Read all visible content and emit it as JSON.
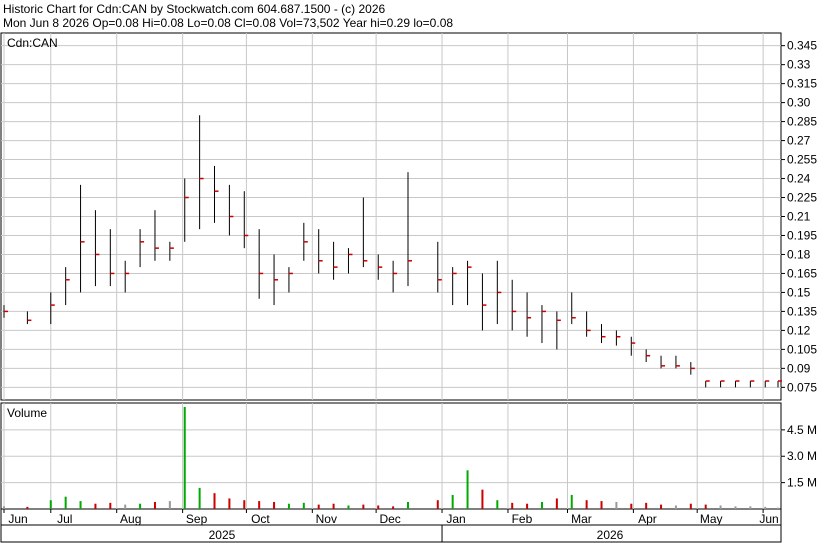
{
  "header": {
    "line1": "Historic Chart for Cdn:CAN by Stockwatch.com 604.687.1500 - (c) 2026",
    "line2": "Mon Jun  8 2026  Op=0.08  Hi=0.08  Lo=0.08  Cl=0.08  Vol=73,502  Year hi=0.29  lo=0.08"
  },
  "colors": {
    "price": "#000000",
    "close_tick": "#cc0000",
    "vol_up": "#00aa00",
    "vol_down": "#cc0000",
    "vol_flat": "#999999",
    "grid": "#c8c8c8"
  },
  "chart_data": [
    {
      "type": "bar",
      "title": "Cdn:CAN",
      "ylabel": "",
      "ylim": [
        0.065,
        0.355
      ],
      "y_ticks": [
        "0.345",
        "0.33",
        "0.315",
        "0.30",
        "0.285",
        "0.27",
        "0.255",
        "0.24",
        "0.225",
        "0.21",
        "0.195",
        "0.18",
        "0.165",
        "0.15",
        "0.135",
        "0.12",
        "0.105",
        "0.09",
        "0.075"
      ],
      "y_tick_values": [
        0.345,
        0.33,
        0.315,
        0.3,
        0.285,
        0.27,
        0.255,
        0.24,
        0.225,
        0.21,
        0.195,
        0.18,
        0.165,
        0.15,
        0.135,
        0.12,
        0.105,
        0.09,
        0.075
      ],
      "grid": true,
      "x_range": [
        "2025-06-09",
        "2026-06-08"
      ],
      "month_labels": [
        {
          "label": "Jun",
          "date": "2025-06-09"
        },
        {
          "label": "Jul",
          "date": "2025-07-01"
        },
        {
          "label": "Aug",
          "date": "2025-08-01"
        },
        {
          "label": "Sep",
          "date": "2025-09-01"
        },
        {
          "label": "Oct",
          "date": "2025-10-01"
        },
        {
          "label": "Nov",
          "date": "2025-11-01"
        },
        {
          "label": "Dec",
          "date": "2025-12-01"
        },
        {
          "label": "Jan",
          "date": "2026-01-01"
        },
        {
          "label": "Feb",
          "date": "2026-02-01"
        },
        {
          "label": "Mar",
          "date": "2026-03-01"
        },
        {
          "label": "Apr",
          "date": "2026-04-01"
        },
        {
          "label": "May",
          "date": "2026-05-01"
        },
        {
          "label": "Jun",
          "date": "2026-06-01"
        }
      ],
      "year_labels": [
        {
          "label": "2025",
          "from": "2025-06-09",
          "to": "2025-12-31"
        },
        {
          "label": "2026",
          "from": "2026-01-01",
          "to": "2026-06-08"
        }
      ],
      "series": [
        {
          "x": [
            "2025-06-09",
            "2025-06-20",
            "2025-07-01",
            "2025-07-08",
            "2025-07-15",
            "2025-07-22",
            "2025-07-29",
            "2025-08-05",
            "2025-08-12",
            "2025-08-19",
            "2025-08-26",
            "2025-09-02",
            "2025-09-09",
            "2025-09-16",
            "2025-09-23",
            "2025-09-30",
            "2025-10-07",
            "2025-10-14",
            "2025-10-21",
            "2025-10-28",
            "2025-11-04",
            "2025-11-11",
            "2025-11-18",
            "2025-11-25",
            "2025-12-02",
            "2025-12-09",
            "2025-12-16",
            "2025-12-30",
            "2026-01-06",
            "2026-01-13",
            "2026-01-20",
            "2026-01-27",
            "2026-02-03",
            "2026-02-10",
            "2026-02-17",
            "2026-02-24",
            "2026-03-03",
            "2026-03-10",
            "2026-03-17",
            "2026-03-24",
            "2026-03-31",
            "2026-04-07",
            "2026-04-14",
            "2026-04-21",
            "2026-04-28",
            "2026-05-05",
            "2026-05-12",
            "2026-05-19",
            "2026-05-26",
            "2026-06-02",
            "2026-06-08"
          ],
          "high": [
            0.14,
            0.135,
            0.15,
            0.17,
            0.235,
            0.215,
            0.2,
            0.175,
            0.2,
            0.215,
            0.19,
            0.24,
            0.29,
            0.25,
            0.235,
            0.23,
            0.2,
            0.18,
            0.17,
            0.205,
            0.2,
            0.19,
            0.185,
            0.225,
            0.18,
            0.175,
            0.245,
            0.19,
            0.17,
            0.175,
            0.165,
            0.175,
            0.16,
            0.15,
            0.14,
            0.135,
            0.15,
            0.135,
            0.125,
            0.12,
            0.115,
            0.105,
            0.1,
            0.1,
            0.095,
            0.08,
            0.08,
            0.08,
            0.08,
            0.08,
            0.08
          ],
          "low": [
            0.13,
            0.125,
            0.125,
            0.14,
            0.15,
            0.155,
            0.155,
            0.15,
            0.17,
            0.175,
            0.175,
            0.19,
            0.2,
            0.205,
            0.195,
            0.185,
            0.145,
            0.14,
            0.15,
            0.175,
            0.165,
            0.16,
            0.165,
            0.17,
            0.16,
            0.15,
            0.155,
            0.15,
            0.14,
            0.14,
            0.12,
            0.125,
            0.12,
            0.115,
            0.11,
            0.105,
            0.125,
            0.115,
            0.11,
            0.108,
            0.1,
            0.095,
            0.09,
            0.09,
            0.085,
            0.075,
            0.075,
            0.075,
            0.075,
            0.075,
            0.075
          ],
          "close": [
            0.135,
            0.128,
            0.14,
            0.16,
            0.19,
            0.18,
            0.165,
            0.165,
            0.19,
            0.185,
            0.185,
            0.225,
            0.24,
            0.23,
            0.21,
            0.195,
            0.165,
            0.16,
            0.165,
            0.19,
            0.175,
            0.17,
            0.18,
            0.175,
            0.17,
            0.165,
            0.175,
            0.16,
            0.165,
            0.17,
            0.14,
            0.15,
            0.135,
            0.13,
            0.135,
            0.128,
            0.13,
            0.12,
            0.115,
            0.115,
            0.11,
            0.1,
            0.092,
            0.092,
            0.09,
            0.08,
            0.08,
            0.08,
            0.08,
            0.08,
            0.08
          ]
        }
      ]
    },
    {
      "type": "bar",
      "title": "Volume",
      "y_ticks": [
        "4.5 M",
        "3.0 M",
        "1.5 M"
      ],
      "y_tick_values": [
        4500000,
        3000000,
        1500000
      ],
      "ylim": [
        0,
        5800000
      ],
      "series": [
        {
          "x": [
            "2025-06-09",
            "2025-06-20",
            "2025-07-01",
            "2025-07-08",
            "2025-07-15",
            "2025-07-22",
            "2025-07-29",
            "2025-08-05",
            "2025-08-12",
            "2025-08-19",
            "2025-08-26",
            "2025-09-02",
            "2025-09-09",
            "2025-09-16",
            "2025-09-23",
            "2025-09-30",
            "2025-10-07",
            "2025-10-14",
            "2025-10-21",
            "2025-10-28",
            "2025-11-04",
            "2025-11-11",
            "2025-11-18",
            "2025-11-25",
            "2025-12-02",
            "2025-12-09",
            "2025-12-16",
            "2025-12-30",
            "2026-01-06",
            "2026-01-13",
            "2026-01-20",
            "2026-01-27",
            "2026-02-03",
            "2026-02-10",
            "2026-02-17",
            "2026-02-24",
            "2026-03-03",
            "2026-03-10",
            "2026-03-17",
            "2026-03-24",
            "2026-03-31",
            "2026-04-07",
            "2026-04-14",
            "2026-04-21",
            "2026-04-28",
            "2026-05-05",
            "2026-05-12",
            "2026-05-19",
            "2026-05-26",
            "2026-06-02",
            "2026-06-08"
          ],
          "values": [
            150000,
            120000,
            500000,
            700000,
            450000,
            300000,
            350000,
            250000,
            300000,
            400000,
            450000,
            5800000,
            1200000,
            900000,
            600000,
            500000,
            450000,
            400000,
            300000,
            350000,
            250000,
            300000,
            200000,
            250000,
            200000,
            150000,
            400000,
            500000,
            800000,
            2200000,
            1100000,
            500000,
            350000,
            300000,
            400000,
            600000,
            800000,
            500000,
            450000,
            400000,
            300000,
            350000,
            250000,
            200000,
            300000,
            250000,
            200000,
            150000,
            150000,
            120000,
            73502
          ]
        }
      ]
    }
  ]
}
